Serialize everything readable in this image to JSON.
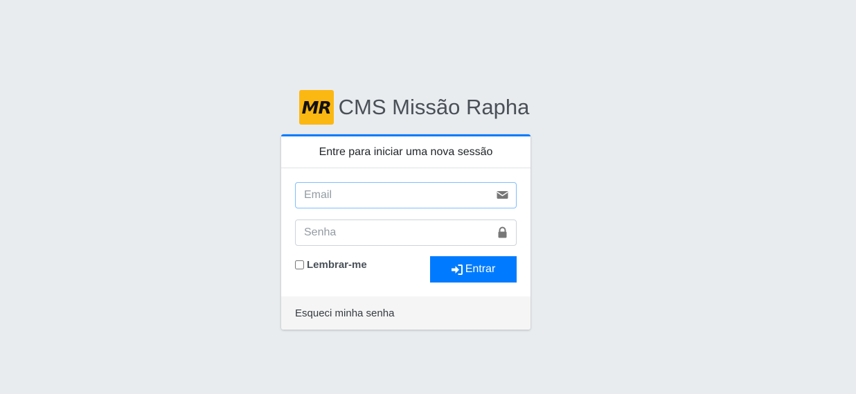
{
  "brand": {
    "logo_text": "MR",
    "name": "CMS Missão Rapha",
    "logo_color": "#fcb812"
  },
  "login": {
    "header": "Entre para iniciar uma nova sessão",
    "email_placeholder": "Email",
    "email_value": "",
    "email_icon": "envelope-icon",
    "password_placeholder": "Senha",
    "password_value": "",
    "password_icon": "lock-icon",
    "remember_label": "Lembrar-me",
    "remember_checked": false,
    "submit_label": "Entrar",
    "submit_icon": "sign-in-icon",
    "forgot_link": "Esqueci minha senha"
  },
  "colors": {
    "accent": "#007bff",
    "background": "#e9ecef"
  }
}
